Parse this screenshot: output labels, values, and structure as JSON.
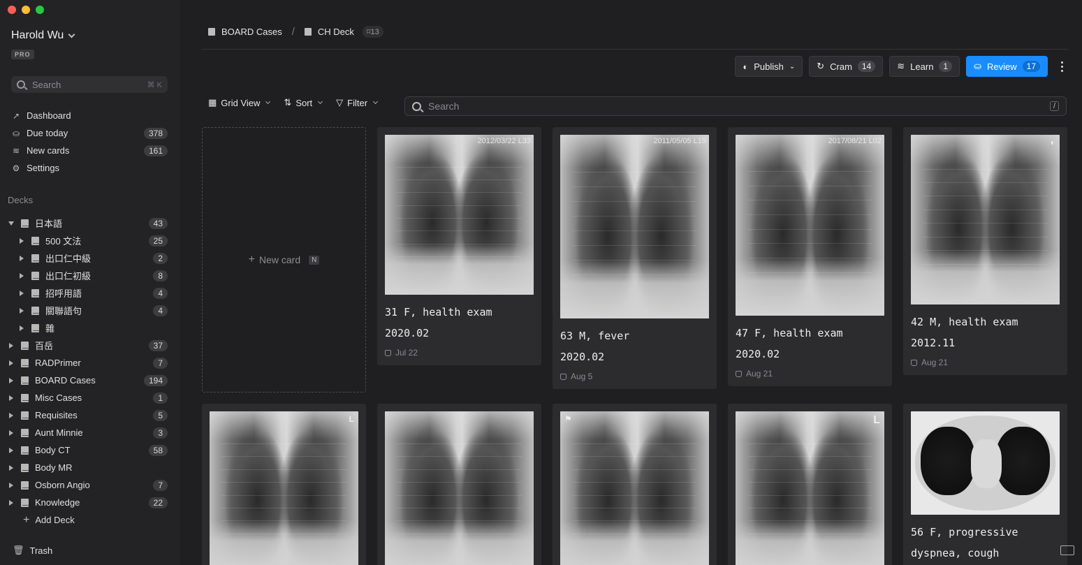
{
  "window": {
    "traffic_colors": [
      "#ff5f57",
      "#febc2e",
      "#28c840"
    ]
  },
  "user": {
    "name": "Harold Wu",
    "plan": "PRO"
  },
  "sidebar_search": {
    "placeholder": "Search",
    "shortcut": "⌘ K"
  },
  "nav": [
    {
      "label": "Dashboard",
      "icon": "trend-icon",
      "count": ""
    },
    {
      "label": "Due today",
      "icon": "inbox-icon",
      "count": "378"
    },
    {
      "label": "New cards",
      "icon": "layers-icon",
      "count": "161"
    },
    {
      "label": "Settings",
      "icon": "gear-icon",
      "count": ""
    }
  ],
  "decks_label": "Decks",
  "decks": [
    {
      "label": "日本語",
      "count": "43",
      "expanded": true,
      "child": false
    },
    {
      "label": "500 文法",
      "count": "25",
      "expanded": false,
      "child": true
    },
    {
      "label": "出口仁中級",
      "count": "2",
      "expanded": false,
      "child": true
    },
    {
      "label": "出口仁初級",
      "count": "8",
      "expanded": false,
      "child": true
    },
    {
      "label": "招呼用語",
      "count": "4",
      "expanded": false,
      "child": true
    },
    {
      "label": "關聯語句",
      "count": "4",
      "expanded": false,
      "child": true
    },
    {
      "label": "雜",
      "count": "",
      "expanded": false,
      "child": true
    },
    {
      "label": "百岳",
      "count": "37",
      "expanded": false,
      "child": false
    },
    {
      "label": "RADPrimer",
      "count": "7",
      "expanded": false,
      "child": false
    },
    {
      "label": "BOARD Cases",
      "count": "194",
      "expanded": false,
      "child": false
    },
    {
      "label": "Misc Cases",
      "count": "1",
      "expanded": false,
      "child": false
    },
    {
      "label": "Requisites",
      "count": "5",
      "expanded": false,
      "child": false
    },
    {
      "label": "Aunt Minnie",
      "count": "3",
      "expanded": false,
      "child": false
    },
    {
      "label": "Body CT",
      "count": "58",
      "expanded": false,
      "child": false
    },
    {
      "label": "Body MR",
      "count": "",
      "expanded": false,
      "child": false
    },
    {
      "label": "Osborn Angio",
      "count": "7",
      "expanded": false,
      "child": false
    },
    {
      "label": "Knowledge",
      "count": "22",
      "expanded": false,
      "child": false
    }
  ],
  "add_deck": "Add Deck",
  "trash": "Trash",
  "breadcrumb": {
    "parent": "BOARD Cases",
    "current": "CH Deck",
    "count": "13"
  },
  "actions": {
    "publish": "Publish",
    "cram": {
      "label": "Cram",
      "count": "14"
    },
    "learn": {
      "label": "Learn",
      "count": "1"
    },
    "review": {
      "label": "Review",
      "count": "17"
    },
    "accent": "#1a8cff"
  },
  "toolbar": {
    "view": "Grid View",
    "sort": "Sort",
    "filter": "Filter",
    "search_placeholder": "Search",
    "search_shortcut": "/"
  },
  "new_card": {
    "label": "New card",
    "shortcut": "N"
  },
  "cards": [
    {
      "stamp": "2012/03/22 L33",
      "line1": "31 F, health exam",
      "line2": "2020.02",
      "date": "Jul 22"
    },
    {
      "stamp": "2011/05/05 L19",
      "line1": "63 M, fever",
      "line2": "2020.02",
      "date": "Aug 5"
    },
    {
      "stamp": "2017/08/21  L02",
      "line1": "47 F, health exam",
      "line2": "2020.02",
      "date": "Aug 21"
    },
    {
      "stamp": "",
      "line1": "42 M, health exam",
      "line2": "2012.11",
      "date": "Aug 21"
    },
    {
      "stamp": "",
      "line1": "",
      "line2": "",
      "date": ""
    },
    {
      "stamp": "",
      "line1": "",
      "line2": "",
      "date": ""
    },
    {
      "stamp": "",
      "line1": "",
      "line2": "",
      "date": ""
    },
    {
      "stamp": "",
      "line1": "",
      "line2": "",
      "date": ""
    },
    {
      "stamp": "",
      "line1": "56 F, progressive",
      "line2": "dyspnea, cough",
      "date": ""
    }
  ]
}
